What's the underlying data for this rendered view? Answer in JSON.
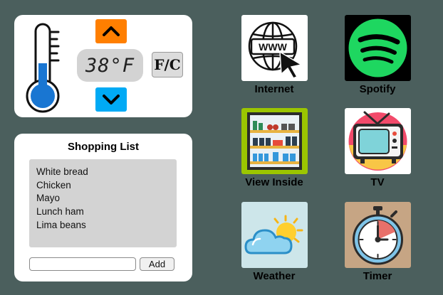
{
  "thermostat": {
    "temperature": "38°F",
    "unit_toggle_label": "F/C"
  },
  "shopping_list": {
    "title": "Shopping List",
    "items": [
      "White bread",
      "Chicken",
      "Mayo",
      "Lunch ham",
      "Lima beans"
    ],
    "input_value": "",
    "add_label": "Add"
  },
  "apps": [
    {
      "label": "Internet",
      "icon": "www-globe-icon"
    },
    {
      "label": "Spotify",
      "icon": "spotify-icon"
    },
    {
      "label": "View Inside",
      "icon": "fridge-shelves-icon"
    },
    {
      "label": "TV",
      "icon": "tv-icon"
    },
    {
      "label": "Weather",
      "icon": "weather-icon"
    },
    {
      "label": "Timer",
      "icon": "stopwatch-icon"
    }
  ],
  "colors": {
    "background": "#4b5f5d",
    "up_button": "#ff7f00",
    "down_button": "#00aaf5",
    "spotify_green": "#1ed760",
    "thermometer_fill": "#1976d2"
  }
}
